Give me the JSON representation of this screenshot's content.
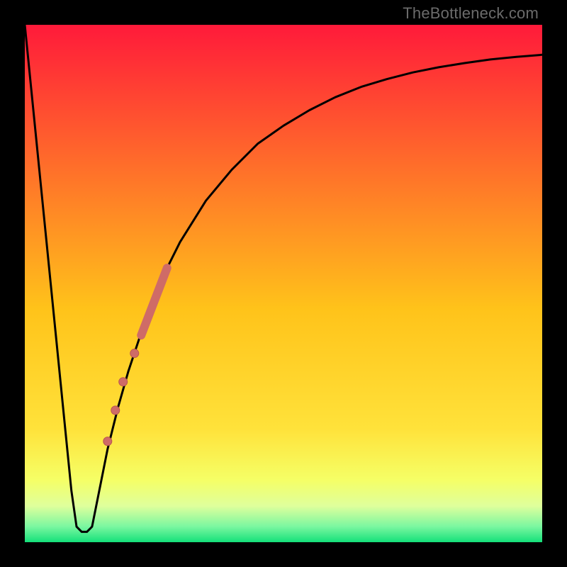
{
  "watermark": "TheBottleneck.com",
  "colors": {
    "frame": "#000000",
    "grad_top": "#ff1a3a",
    "grad_mid": "#ffd11a",
    "grad_low": "#f5ff66",
    "grad_band_top": "#dfff9c",
    "grad_bottom": "#14e07a",
    "curve": "#000000",
    "marker_fill": "#cf6b67",
    "marker_stroke": "#b85551"
  },
  "chart_data": {
    "type": "line",
    "title": "",
    "xlabel": "",
    "ylabel": "",
    "xlim": [
      0,
      100
    ],
    "ylim": [
      0,
      100
    ],
    "series": [
      {
        "name": "bottleneck-curve",
        "x": [
          0,
          2,
          4,
          6,
          8,
          9,
          10,
          11,
          12,
          13,
          14,
          16,
          18,
          20,
          22,
          24,
          26,
          30,
          35,
          40,
          45,
          50,
          55,
          60,
          65,
          70,
          75,
          80,
          85,
          90,
          95,
          100
        ],
        "y": [
          100,
          80,
          60,
          40,
          20,
          10,
          3,
          2,
          2,
          3,
          8,
          18,
          26,
          33,
          39,
          45,
          50,
          58,
          66,
          72,
          77,
          80.5,
          83.5,
          86,
          88,
          89.5,
          90.8,
          91.8,
          92.6,
          93.3,
          93.8,
          94.2
        ]
      }
    ],
    "markers": [
      {
        "name": "highlighted-range-thick",
        "kind": "line-segment",
        "x": [
          22.5,
          27.5
        ],
        "y": [
          40,
          53
        ],
        "width": 12
      },
      {
        "name": "dot-1",
        "kind": "point",
        "x": 21.2,
        "y": 36.5,
        "r": 6
      },
      {
        "name": "dot-2",
        "kind": "point",
        "x": 19.0,
        "y": 31.0,
        "r": 6
      },
      {
        "name": "dot-3",
        "kind": "point",
        "x": 17.5,
        "y": 25.5,
        "r": 6
      },
      {
        "name": "dot-4",
        "kind": "point",
        "x": 16.0,
        "y": 19.5,
        "r": 6
      }
    ],
    "annotations": []
  }
}
